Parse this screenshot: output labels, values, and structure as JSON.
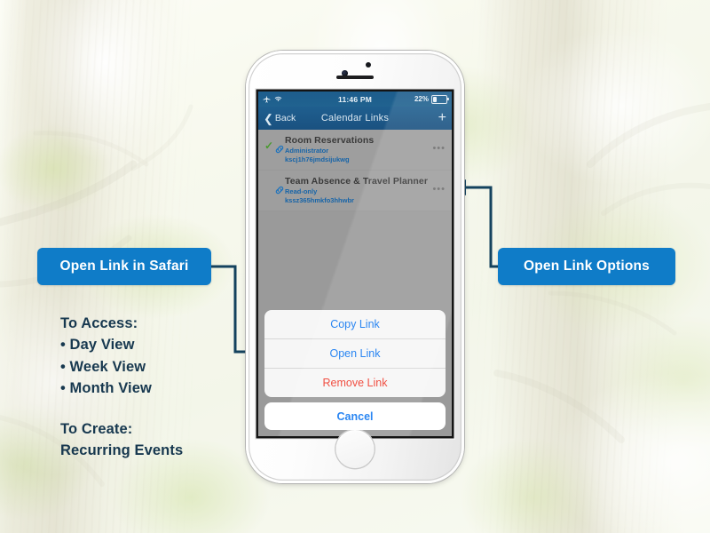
{
  "callouts": {
    "safari": "Open Link in Safari",
    "options": "Open Link Options"
  },
  "info": {
    "access_heading": "To Access:",
    "access_items": [
      "• Day View",
      "• Week View",
      "• Month View"
    ],
    "create_heading": "To Create:",
    "create_items": [
      "Recurring Events"
    ]
  },
  "phone": {
    "status_bar": {
      "time": "11:46 PM",
      "battery_percent": "22%",
      "airplane_icon": "airplane-icon",
      "wifi_icon": "wifi-icon",
      "battery_icon": "battery-icon"
    },
    "nav_bar": {
      "back_label": "Back",
      "title": "Calendar Links",
      "add_label": "+"
    },
    "list": [
      {
        "title": "Room Reservations",
        "role": "Administrator",
        "code": "kscj1h76jmdsijukwg",
        "checked": true,
        "more_label": "•••"
      },
      {
        "title": "Team Absence & Travel Planner",
        "role": "Read-only",
        "code": "kssz365hmkfo3hhwbr",
        "checked": false,
        "more_label": "•••"
      }
    ],
    "action_sheet": {
      "items": [
        "Copy Link",
        "Open Link",
        "Remove Link"
      ],
      "cancel_label": "Cancel"
    }
  },
  "colors": {
    "accent_blue": "#0f7cc8",
    "text_navy": "#17384f",
    "ios_blue": "#1278f1",
    "destructive_red": "#ef3b2d",
    "check_green": "#4a9a30",
    "nav_blue": "#1f5f8f"
  }
}
